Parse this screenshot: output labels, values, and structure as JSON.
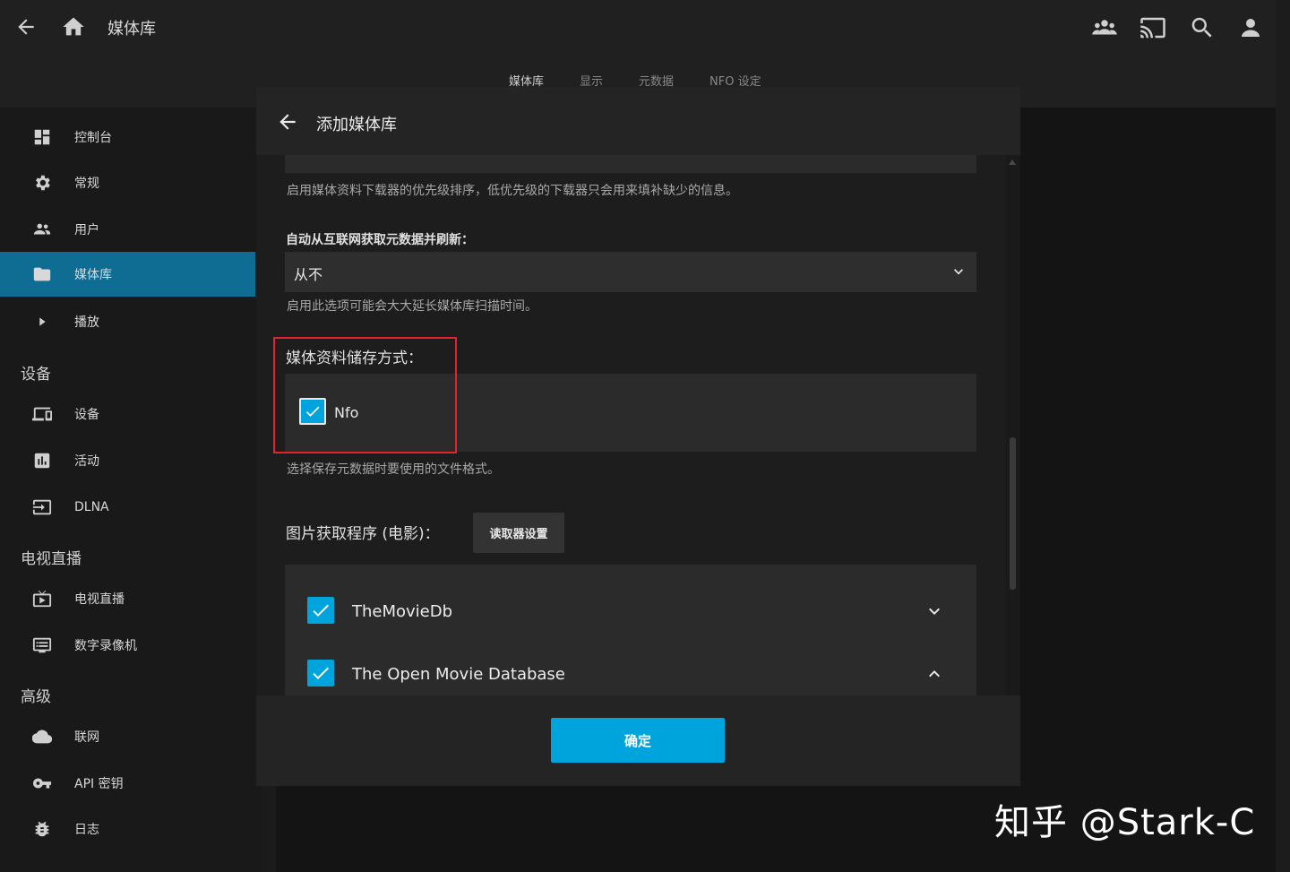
{
  "header": {
    "title": "媒体库",
    "tabs": [
      "媒体库",
      "显示",
      "元数据",
      "NFO 设定"
    ]
  },
  "sidebar": {
    "items": [
      {
        "label": "控制台",
        "icon": "dashboard-icon"
      },
      {
        "label": "常规",
        "icon": "gear-icon"
      },
      {
        "label": "用户",
        "icon": "users-icon"
      },
      {
        "label": "媒体库",
        "icon": "folder-icon"
      },
      {
        "label": "播放",
        "icon": "play-icon"
      }
    ],
    "section_devices": "设备",
    "devices": [
      {
        "label": "设备",
        "icon": "devices-icon"
      },
      {
        "label": "活动",
        "icon": "activity-icon"
      },
      {
        "label": "DLNA",
        "icon": "dlna-icon"
      }
    ],
    "section_livetv": "电视直播",
    "livetv": [
      {
        "label": "电视直播",
        "icon": "live-tv-icon"
      },
      {
        "label": "数字录像机",
        "icon": "dvr-icon"
      }
    ],
    "section_advanced": "高级",
    "advanced": [
      {
        "label": "联网",
        "icon": "cloud-icon"
      },
      {
        "label": "API 密钥",
        "icon": "key-icon"
      },
      {
        "label": "日志",
        "icon": "bug-icon"
      }
    ]
  },
  "dialog": {
    "title": "添加媒体库",
    "downloader_priority_desc": "启用媒体资料下载器的优先级排序，低优先级的下载器只会用来填补缺少的信息。",
    "auto_refresh_label": "自动从互联网获取元数据并刷新：",
    "auto_refresh_value": "从不",
    "auto_refresh_desc": "启用此选项可能会大大延长媒体库扫描时间。",
    "metadata_saver_label": "媒体资料储存方式：",
    "metadata_saver_option": "Nfo",
    "metadata_saver_desc": "选择保存元数据时要使用的文件格式。",
    "image_fetchers_label": "图片获取程序 (电影)：",
    "fetcher_settings_button": "读取器设置",
    "fetchers": [
      {
        "name": "TheMovieDb",
        "checked": true,
        "expand": "chevron-down-icon"
      },
      {
        "name": "The Open Movie Database",
        "checked": true,
        "expand": "chevron-up-icon"
      }
    ],
    "ok_button": "确定"
  },
  "watermark": "知乎 @Stark-C",
  "colors": {
    "accent": "#00a4dc",
    "active_nav": "#0f6d93",
    "highlight": "#e3232c"
  }
}
